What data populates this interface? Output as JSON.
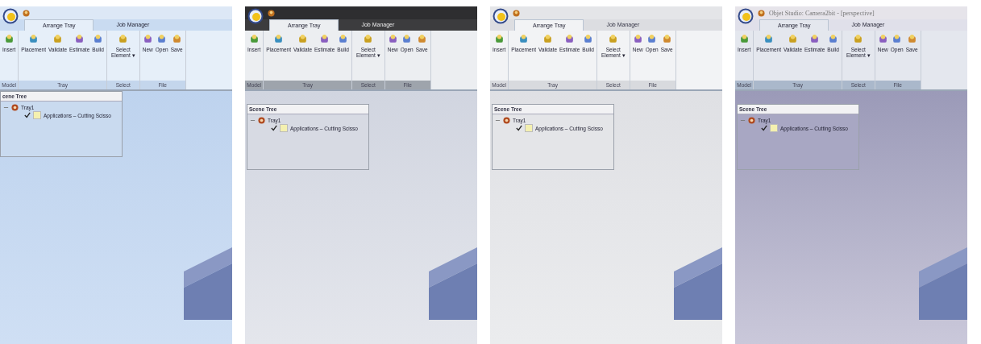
{
  "panels": [
    {
      "kind": "blue",
      "tabs": [
        {
          "label": "Arrange Tray",
          "selected": true
        },
        {
          "label": "Job Manager",
          "selected": false
        }
      ],
      "groups": [
        {
          "label": "Model",
          "buttons": [
            {
              "label": "Insert"
            }
          ]
        },
        {
          "label": "Tray",
          "buttons": [
            {
              "label": "Placement"
            },
            {
              "label": "Validate"
            },
            {
              "label": "Estimate"
            },
            {
              "label": "Build"
            }
          ]
        },
        {
          "label": "Select",
          "buttons": [
            {
              "label": "Select Element ▾"
            }
          ]
        },
        {
          "label": "File",
          "buttons": [
            {
              "label": "New"
            },
            {
              "label": "Open"
            },
            {
              "label": "Save"
            }
          ]
        }
      ],
      "scene_tree": {
        "title": "cene Tree",
        "nodes": [
          {
            "label": "Tray1",
            "expanded": true,
            "children": [
              {
                "label": "Applications – Cutting Scisso",
                "checked": true
              }
            ]
          }
        ]
      }
    },
    {
      "kind": "black",
      "tabs": [
        {
          "label": "Arrange Tray",
          "selected": true
        },
        {
          "label": "Job Manager",
          "selected": false
        }
      ],
      "groups": [
        {
          "label": "Model",
          "buttons": [
            {
              "label": "Insert"
            }
          ]
        },
        {
          "label": "Tray",
          "buttons": [
            {
              "label": "Placement"
            },
            {
              "label": "Validate"
            },
            {
              "label": "Estimate"
            },
            {
              "label": "Build"
            }
          ]
        },
        {
          "label": "Select",
          "buttons": [
            {
              "label": "Select Element ▾"
            }
          ]
        },
        {
          "label": "File",
          "buttons": [
            {
              "label": "New"
            },
            {
              "label": "Open"
            },
            {
              "label": "Save"
            }
          ]
        }
      ],
      "scene_tree": {
        "title": "Scene Tree",
        "nodes": [
          {
            "label": "Tray1",
            "expanded": true,
            "children": [
              {
                "label": "Applications – Cutting Scisso",
                "checked": true
              }
            ]
          }
        ]
      }
    },
    {
      "kind": "silver",
      "tabs": [
        {
          "label": "Arrange Tray",
          "selected": true
        },
        {
          "label": "Job Manager",
          "selected": false
        }
      ],
      "groups": [
        {
          "label": "Model",
          "buttons": [
            {
              "label": "Insert"
            }
          ]
        },
        {
          "label": "Tray",
          "buttons": [
            {
              "label": "Placement"
            },
            {
              "label": "Validate"
            },
            {
              "label": "Estimate"
            },
            {
              "label": "Build"
            }
          ]
        },
        {
          "label": "Select",
          "buttons": [
            {
              "label": "Select Element ▾"
            }
          ]
        },
        {
          "label": "File",
          "buttons": [
            {
              "label": "New"
            },
            {
              "label": "Open"
            },
            {
              "label": "Save"
            }
          ]
        }
      ],
      "scene_tree": {
        "title": "Scene Tree",
        "nodes": [
          {
            "label": "Tray1",
            "expanded": true,
            "children": [
              {
                "label": "Applications – Cutting Scisso",
                "checked": true
              }
            ]
          }
        ]
      }
    },
    {
      "kind": "lilac",
      "title": "Objet Studio: Camera2bit - [perspective]",
      "tabs": [
        {
          "label": "Arrange Tray",
          "selected": true
        },
        {
          "label": "Job Manager",
          "selected": false
        }
      ],
      "groups": [
        {
          "label": "Model",
          "buttons": [
            {
              "label": "Insert"
            }
          ]
        },
        {
          "label": "Tray",
          "buttons": [
            {
              "label": "Placement"
            },
            {
              "label": "Validate"
            },
            {
              "label": "Estimate"
            },
            {
              "label": "Build"
            }
          ]
        },
        {
          "label": "Select",
          "buttons": [
            {
              "label": "Select Element ▾"
            }
          ]
        },
        {
          "label": "File",
          "buttons": [
            {
              "label": "New"
            },
            {
              "label": "Open"
            },
            {
              "label": "Save"
            }
          ]
        }
      ],
      "scene_tree": {
        "title": "Scene Tree",
        "nodes": [
          {
            "label": "Tray1",
            "expanded": true,
            "children": [
              {
                "label": "Applications – Cutting Scisso",
                "checked": true
              }
            ]
          }
        ]
      }
    }
  ]
}
